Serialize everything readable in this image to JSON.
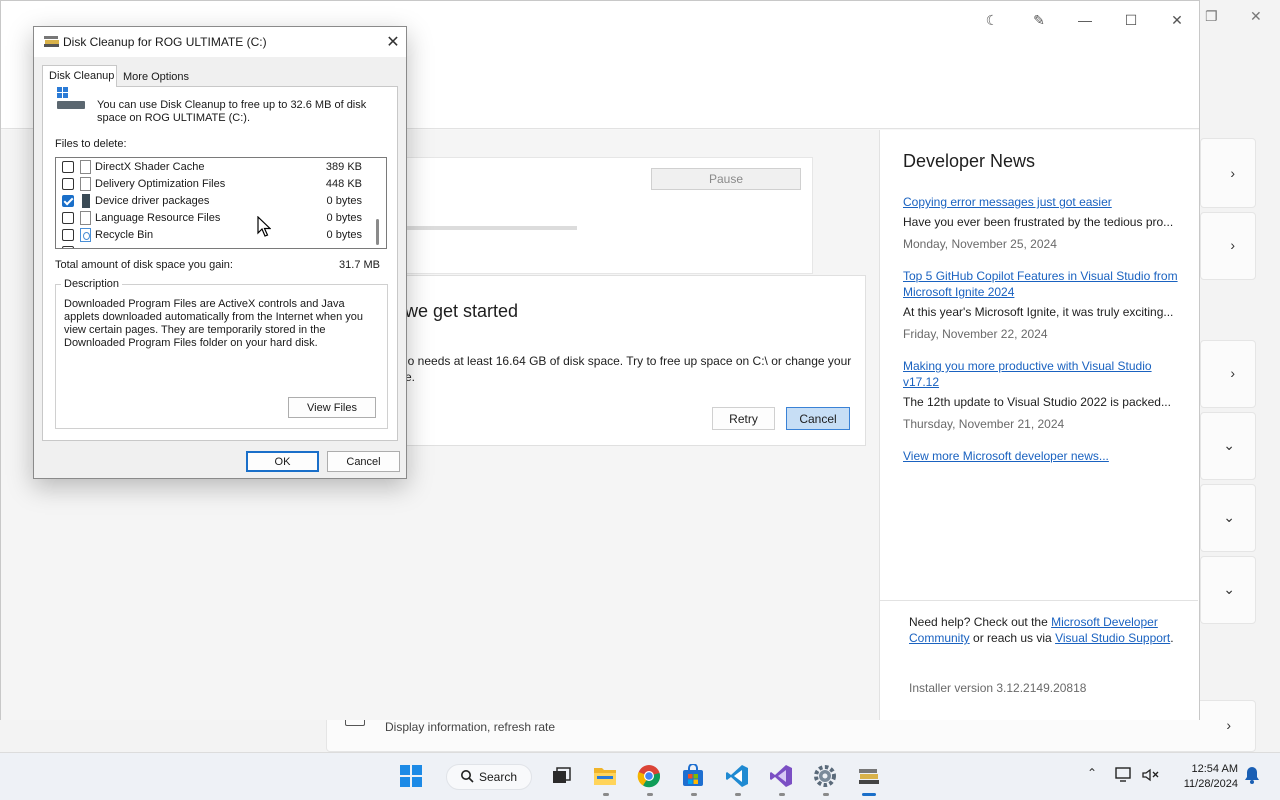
{
  "settings_bg": {
    "display_info": "Display information, refresh rate"
  },
  "vs_installer": {
    "title_buttons": [
      "moon-icon",
      "feedback-icon",
      "minimize-icon",
      "maximize-icon",
      "close-icon"
    ],
    "pause_label": "Pause",
    "error": {
      "title": "we get started",
      "message": "io needs at least 16.64 GB of disk space. Try to free up space on C:\\ or change your e.",
      "retry_label": "Retry",
      "cancel_label": "Cancel"
    },
    "news": {
      "heading": "Developer News",
      "items": [
        {
          "link": "Copying error messages just got easier",
          "summary": "Have you ever been frustrated by the tedious pro...",
          "date": "Monday, November 25, 2024"
        },
        {
          "link": "Top 5 GitHub Copilot Features in Visual Studio from Microsoft Ignite 2024",
          "summary": "At this year's Microsoft Ignite, it was truly exciting...",
          "date": "Friday, November 22, 2024"
        },
        {
          "link": "Making you more productive with Visual Studio v17.12",
          "summary": "The 12th update to Visual Studio 2022 is packed...",
          "date": "Thursday, November 21, 2024"
        }
      ],
      "view_more": "View more Microsoft developer news..."
    },
    "help": {
      "prefix": "Need help? Check out the ",
      "community_link": "Microsoft Developer Community",
      "middle": " or reach us via ",
      "support_link": "Visual Studio Support",
      "suffix": "."
    },
    "installer_version": "Installer version 3.12.2149.20818"
  },
  "disk_cleanup": {
    "title": "Disk Cleanup for ROG ULTIMATE (C:)",
    "tabs": [
      "Disk Cleanup",
      "More Options"
    ],
    "intro": "You can use Disk Cleanup to free up to 32.6 MB of disk space on ROG ULTIMATE (C:).",
    "files_label": "Files to delete:",
    "files": [
      {
        "name": "DirectX Shader Cache",
        "size": "389 KB",
        "checked": false
      },
      {
        "name": "Delivery Optimization Files",
        "size": "448 KB",
        "checked": false
      },
      {
        "name": "Device driver packages",
        "size": "0 bytes",
        "checked": true
      },
      {
        "name": "Language Resource Files",
        "size": "0 bytes",
        "checked": false
      },
      {
        "name": "Recycle Bin",
        "size": "0 bytes",
        "checked": false
      }
    ],
    "total_label": "Total amount of disk space you gain:",
    "total_value": "31.7 MB",
    "description_label": "Description",
    "description_text": "Downloaded Program Files are ActiveX controls and Java applets downloaded automatically from the Internet when you view certain pages. They are temporarily stored in the Downloaded Program Files folder on your hard disk.",
    "view_files_label": "View Files",
    "ok_label": "OK",
    "cancel_label": "Cancel"
  },
  "taskbar": {
    "search_label": "Search",
    "apps": [
      "start-icon",
      "task-view-icon",
      "file-explorer-icon",
      "chrome-icon",
      "store-icon",
      "vscode-icon",
      "visual-studio-icon",
      "settings-icon",
      "disk-cleanup-icon"
    ],
    "time": "12:54 AM",
    "date": "11/28/2024"
  },
  "colors": {
    "accent": "#1a6fc9",
    "link": "#1a62c0"
  }
}
